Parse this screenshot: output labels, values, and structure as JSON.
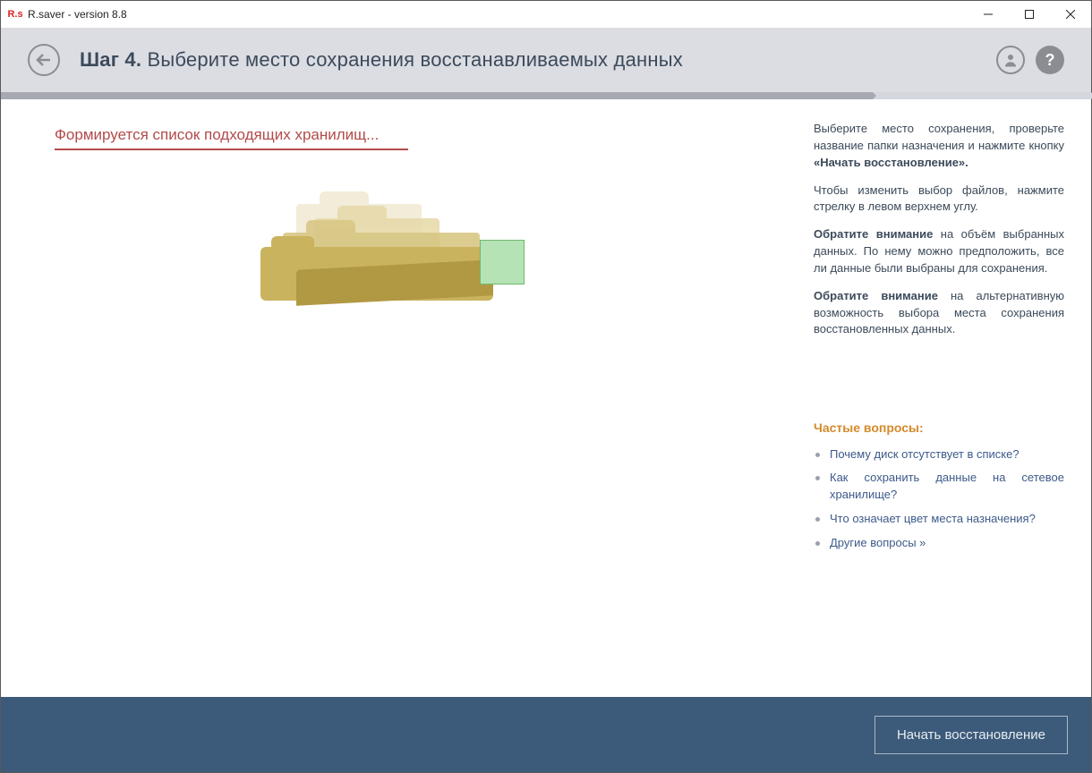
{
  "window": {
    "title": "R.saver - version 8.8",
    "icon_text": "R.s"
  },
  "header": {
    "step_label": "Шаг 4.",
    "title": "Выберите место сохранения восстанавливаемых данных"
  },
  "status_text": "Формируется список подходящих хранилищ...",
  "help_panel": {
    "p1_prefix": "Выберите место сохранения, проверьте название папки назначения и нажмите кнопку ",
    "p1_bold": "«Начать восстановление».",
    "p2": "Чтобы изменить выбор файлов, нажмите стрелку в левом верхнем углу.",
    "p3_bold": "Обратите внимание",
    "p3_rest": " на объём выбранных данных. По нему можно предположить, все ли данные были выбраны для сохранения.",
    "p4_bold": "Обратите внимание",
    "p4_rest": " на альтернативную возможность выбора места сохранения восстановленных данных."
  },
  "faq": {
    "title": "Частые вопросы:",
    "items": [
      "Почему диск отсутствует в списке?",
      "Как сохранить данные на сетевое хранилище?",
      "Что означает цвет места назначения?",
      "Другие вопросы »"
    ]
  },
  "footer": {
    "primary_button": "Начать восстановление"
  }
}
